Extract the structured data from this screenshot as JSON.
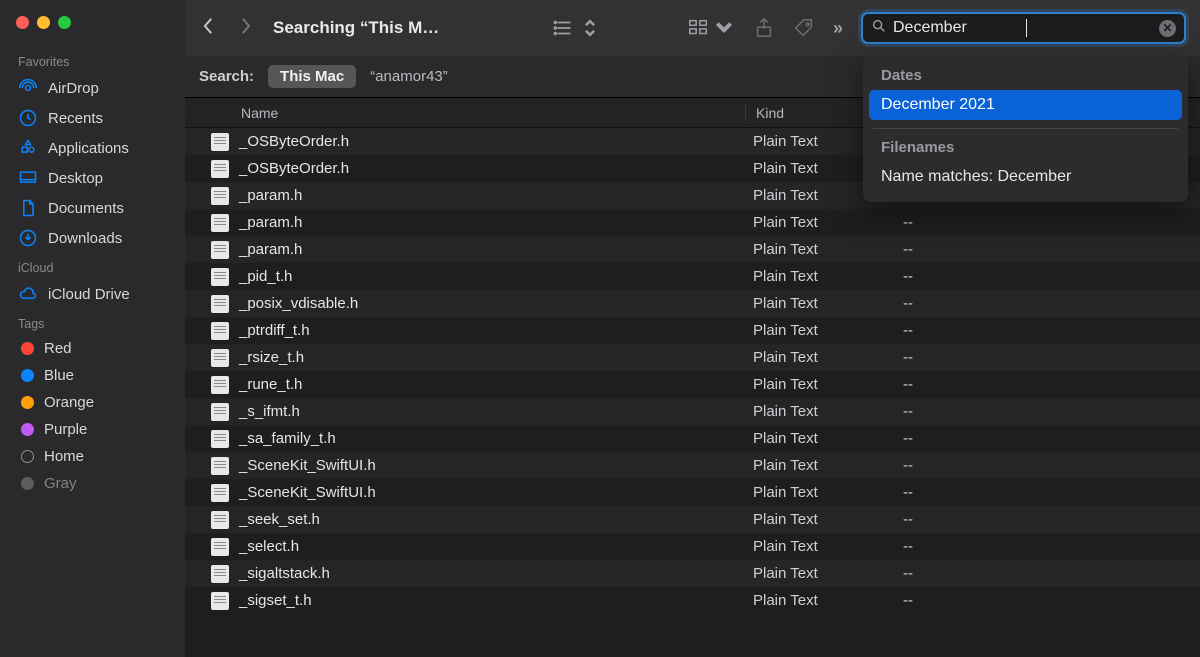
{
  "window": {
    "title": "Searching “This M…"
  },
  "sidebar": {
    "sections": [
      {
        "title": "Favorites",
        "items": [
          {
            "icon": "airdrop",
            "label": "AirDrop"
          },
          {
            "icon": "recents",
            "label": "Recents"
          },
          {
            "icon": "apps",
            "label": "Applications"
          },
          {
            "icon": "desktop",
            "label": "Desktop"
          },
          {
            "icon": "documents",
            "label": "Documents"
          },
          {
            "icon": "downloads",
            "label": "Downloads"
          }
        ]
      },
      {
        "title": "iCloud",
        "items": [
          {
            "icon": "icloud",
            "label": "iCloud Drive"
          }
        ]
      },
      {
        "title": "Tags",
        "items": [
          {
            "icon": "tag-red",
            "label": "Red"
          },
          {
            "icon": "tag-blue",
            "label": "Blue"
          },
          {
            "icon": "tag-orange",
            "label": "Orange"
          },
          {
            "icon": "tag-purple",
            "label": "Purple"
          },
          {
            "icon": "tag-home",
            "label": "Home"
          },
          {
            "icon": "tag-gray",
            "label": "Gray"
          }
        ]
      }
    ]
  },
  "search": {
    "query": "December",
    "scope_label": "Search:",
    "scope_selected": "This Mac",
    "scope_other": "“anamor43”",
    "suggestions": {
      "dates_header": "Dates",
      "date_item": "December 2021",
      "filenames_header": "Filenames",
      "filename_item": "Name matches: December"
    }
  },
  "columns": {
    "name": "Name",
    "kind": "Kind",
    "date": ""
  },
  "files": [
    {
      "name": "_OSByteOrder.h",
      "kind": "Plain Text",
      "date": ""
    },
    {
      "name": "_OSByteOrder.h",
      "kind": "Plain Text",
      "date": ""
    },
    {
      "name": "_param.h",
      "kind": "Plain Text",
      "date": "--"
    },
    {
      "name": "_param.h",
      "kind": "Plain Text",
      "date": "--"
    },
    {
      "name": "_param.h",
      "kind": "Plain Text",
      "date": "--"
    },
    {
      "name": "_pid_t.h",
      "kind": "Plain Text",
      "date": "--"
    },
    {
      "name": "_posix_vdisable.h",
      "kind": "Plain Text",
      "date": "--"
    },
    {
      "name": "_ptrdiff_t.h",
      "kind": "Plain Text",
      "date": "--"
    },
    {
      "name": "_rsize_t.h",
      "kind": "Plain Text",
      "date": "--"
    },
    {
      "name": "_rune_t.h",
      "kind": "Plain Text",
      "date": "--"
    },
    {
      "name": "_s_ifmt.h",
      "kind": "Plain Text",
      "date": "--"
    },
    {
      "name": "_sa_family_t.h",
      "kind": "Plain Text",
      "date": "--"
    },
    {
      "name": "_SceneKit_SwiftUI.h",
      "kind": "Plain Text",
      "date": "--"
    },
    {
      "name": "_SceneKit_SwiftUI.h",
      "kind": "Plain Text",
      "date": "--"
    },
    {
      "name": "_seek_set.h",
      "kind": "Plain Text",
      "date": "--"
    },
    {
      "name": "_select.h",
      "kind": "Plain Text",
      "date": "--"
    },
    {
      "name": "_sigaltstack.h",
      "kind": "Plain Text",
      "date": "--"
    },
    {
      "name": "_sigset_t.h",
      "kind": "Plain Text",
      "date": "--"
    }
  ]
}
